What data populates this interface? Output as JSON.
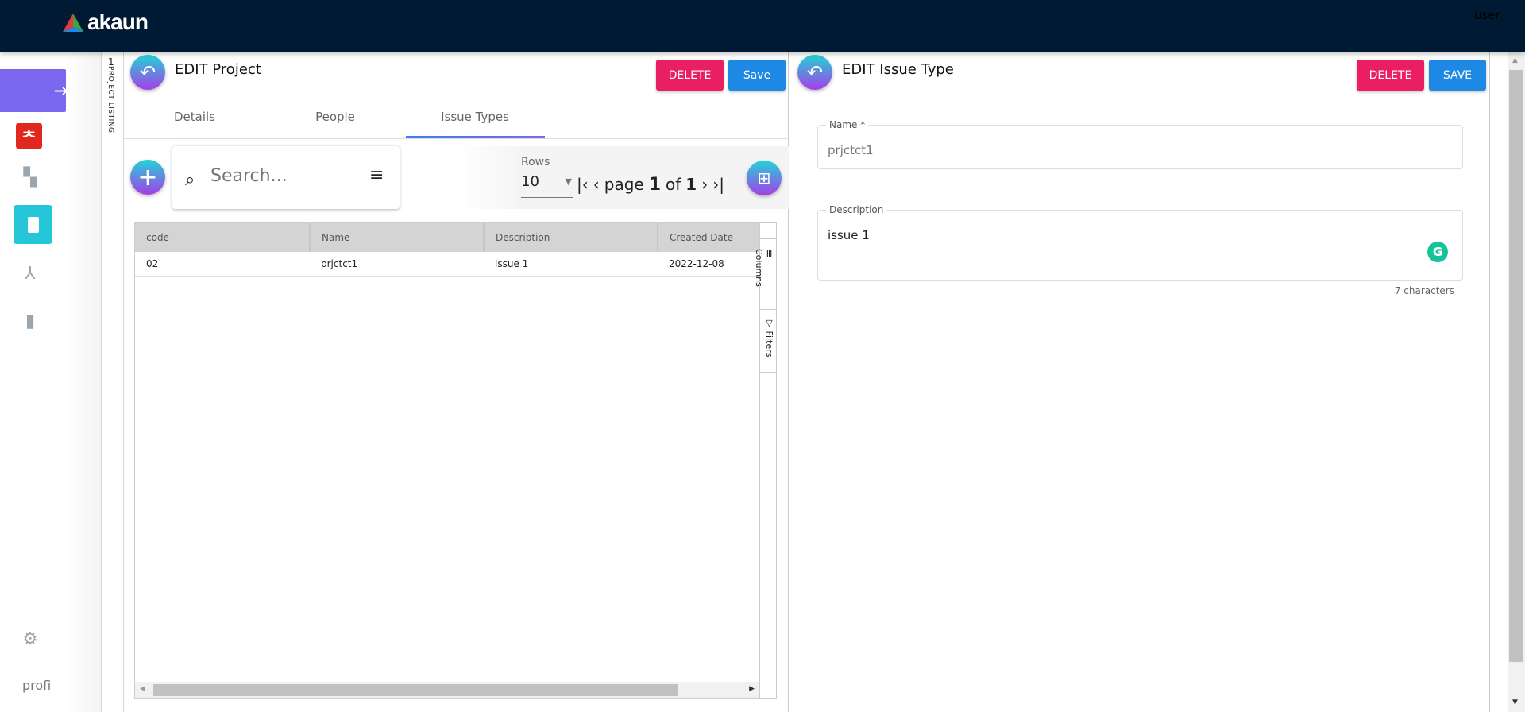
{
  "header": {
    "logo_text": "akaun",
    "user_image_alt": "user"
  },
  "sidebar": {
    "items": [
      {
        "name": "login",
        "icon": "login-icon"
      },
      {
        "name": "app-logo",
        "icon": "red-app-icon"
      },
      {
        "name": "dashboard",
        "icon": "dashboard-icon"
      },
      {
        "name": "projects",
        "icon": "clipboard-icon",
        "active": true
      },
      {
        "name": "hierarchy",
        "icon": "hierarchy-icon"
      },
      {
        "name": "reports",
        "icon": "bar-chart-icon"
      }
    ],
    "settings_icon": "gear-icon",
    "profile_image_alt": "profi",
    "colors": {
      "active": "#7b68ee",
      "active_tile": "#26c6da"
    }
  },
  "strip": {
    "count": "1",
    "label": "PROJECT LISTING"
  },
  "left": {
    "title": "EDIT Project",
    "delete_label": "DELETE",
    "save_label": "Save",
    "tabs": [
      {
        "label": "Details"
      },
      {
        "label": "People"
      },
      {
        "label": "Issue Types",
        "active": true
      }
    ],
    "search": {
      "placeholder": "Search..."
    },
    "pager": {
      "rows_label": "Rows",
      "rows_value": "10",
      "page_word": "page",
      "page": "1",
      "of_word": "of",
      "total": "1"
    },
    "table": {
      "columns": [
        "code",
        "Name",
        "Description",
        "Created Date"
      ],
      "rows": [
        [
          "02",
          "prjctct1",
          "issue 1",
          "2022-12-08"
        ]
      ],
      "side_tools": [
        "Columns",
        "Filters"
      ]
    }
  },
  "right": {
    "title": "EDIT Issue Type",
    "delete_label": "DELETE",
    "save_label": "SAVE",
    "name_label": "Name *",
    "name_value": "prjctct1",
    "desc_label": "Description",
    "desc_value": "issue 1",
    "char_count": "7 characters"
  },
  "colors": {
    "header": "#001a33",
    "delete": "#e91e63",
    "save": "#1e88e5",
    "tab_underline": "#3f7de8",
    "grammarly": "#15c39a"
  }
}
